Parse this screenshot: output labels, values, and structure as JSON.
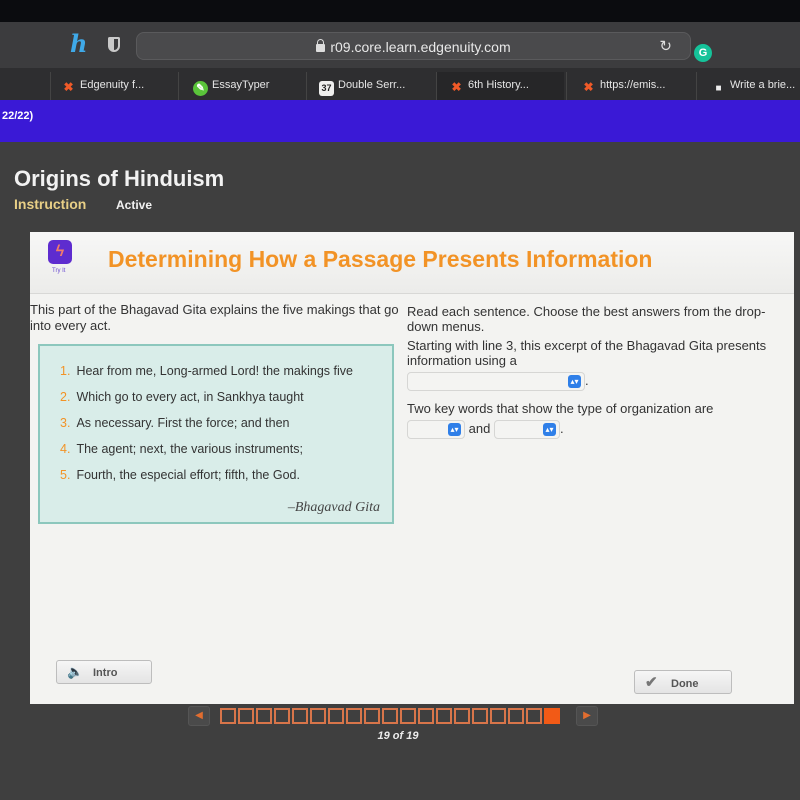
{
  "browser": {
    "url": "r09.core.learn.edgenuity.com",
    "tabs": [
      {
        "label": "Edgenuity f...",
        "icon": "edgenuity-x-icon"
      },
      {
        "label": "EssayTyper",
        "icon": "essaytyper-icon"
      },
      {
        "label": "Double Serr...",
        "icon": "double-icon"
      },
      {
        "label": "6th History...",
        "icon": "edgenuity-x-icon",
        "active": true
      },
      {
        "label": "https://emis...",
        "icon": "edgenuity-x-icon"
      },
      {
        "label": "Write a brie...",
        "icon": "document-icon"
      }
    ],
    "extension_glyph": "G"
  },
  "progress_counter": "22/22)",
  "course": {
    "title": "Origins of Hinduism",
    "breadcrumb_instruction": "Instruction",
    "breadcrumb_status": "Active"
  },
  "activity": {
    "badge_label": "Try It",
    "title": "Determining How a Passage Presents Information",
    "intro": "This part of the Bhagavad Gita explains the five makings that go into every act.",
    "passage": [
      {
        "num": "1.",
        "text": "Hear from me, Long-armed Lord! the makings  five"
      },
      {
        "num": "2.",
        "text": "Which go to every act, in Sankhya taught"
      },
      {
        "num": "3.",
        "text": "As necessary. First the force; and then"
      },
      {
        "num": "4.",
        "text": "The agent; next, the various instruments;"
      },
      {
        "num": "5.",
        "text": "Fourth, the especial effort; fifth, the God."
      }
    ],
    "attribution": "–Bhagavad Gita",
    "instructions": "Read each sentence. Choose the best answers from the drop-down menus.",
    "question1": "Starting with line 3, this excerpt of the Bhagavad Gita presents information using a",
    "question1_answer": "",
    "question2": "Two key words that show the type of organization are",
    "question2_answer1": "",
    "question2_joiner": "and",
    "question2_answer2": "",
    "period": "."
  },
  "buttons": {
    "intro": "Intro",
    "done": "Done"
  },
  "pager": {
    "current": 19,
    "total": 19,
    "label": "19 of 19"
  }
}
